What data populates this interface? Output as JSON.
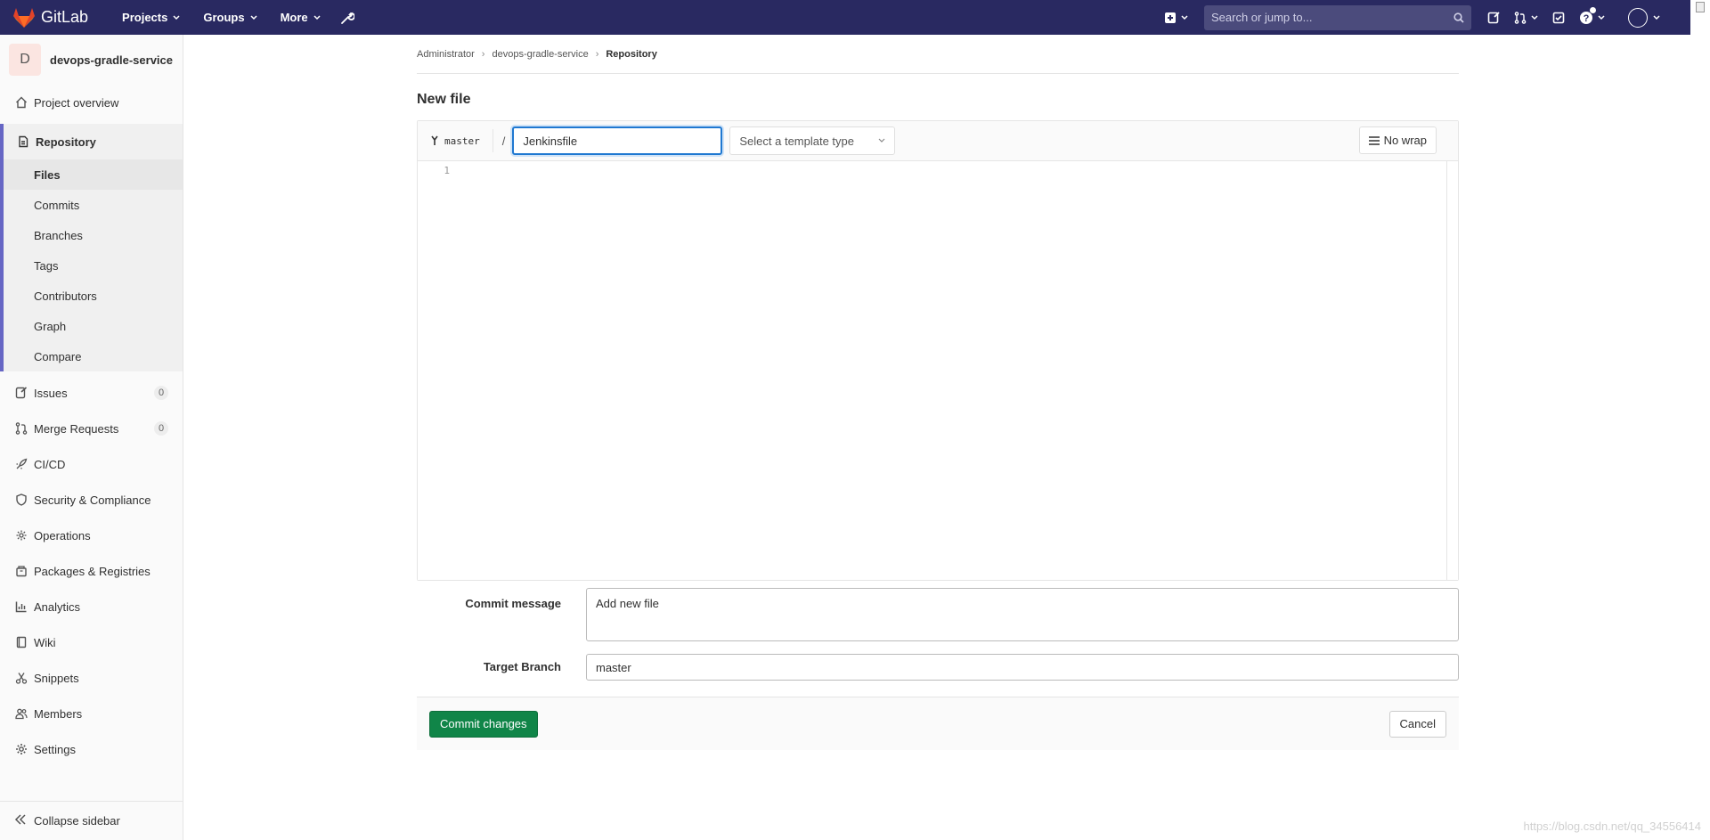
{
  "navbar": {
    "brand": "GitLab",
    "links": [
      {
        "label": "Projects"
      },
      {
        "label": "Groups"
      },
      {
        "label": "More"
      }
    ],
    "search_placeholder": "Search or jump to..."
  },
  "sidebar": {
    "project_initial": "D",
    "project_name": "devops-gradle-service",
    "project_overview": "Project overview",
    "repository": {
      "label": "Repository",
      "sub_items": [
        "Files",
        "Commits",
        "Branches",
        "Tags",
        "Contributors",
        "Graph",
        "Compare"
      ]
    },
    "issues": {
      "label": "Issues",
      "count": "0"
    },
    "merge_requests": {
      "label": "Merge Requests",
      "count": "0"
    },
    "cicd": "CI/CD",
    "security": "Security & Compliance",
    "operations": "Operations",
    "packages": "Packages & Registries",
    "analytics": "Analytics",
    "wiki": "Wiki",
    "snippets": "Snippets",
    "members": "Members",
    "settings": "Settings",
    "collapse": "Collapse sidebar"
  },
  "breadcrumb": {
    "items": [
      "Administrator",
      "devops-gradle-service",
      "Repository"
    ]
  },
  "page": {
    "title": "New file"
  },
  "editor": {
    "branch": "master",
    "separator": "/",
    "file_name": "Jenkinsfile",
    "template_placeholder": "Select a template type",
    "no_wrap": "No wrap",
    "line_number": "1"
  },
  "form": {
    "commit_label": "Commit message",
    "commit_value": "Add new file",
    "target_label": "Target Branch",
    "target_value": "master"
  },
  "actions": {
    "commit": "Commit changes",
    "cancel": "Cancel"
  },
  "watermark": "https://blog.csdn.net/qq_34556414",
  "colors": {
    "navbar": "#292961",
    "accent": "#6666c4",
    "commit_button": "#108548",
    "focus": "#1f78d1"
  }
}
